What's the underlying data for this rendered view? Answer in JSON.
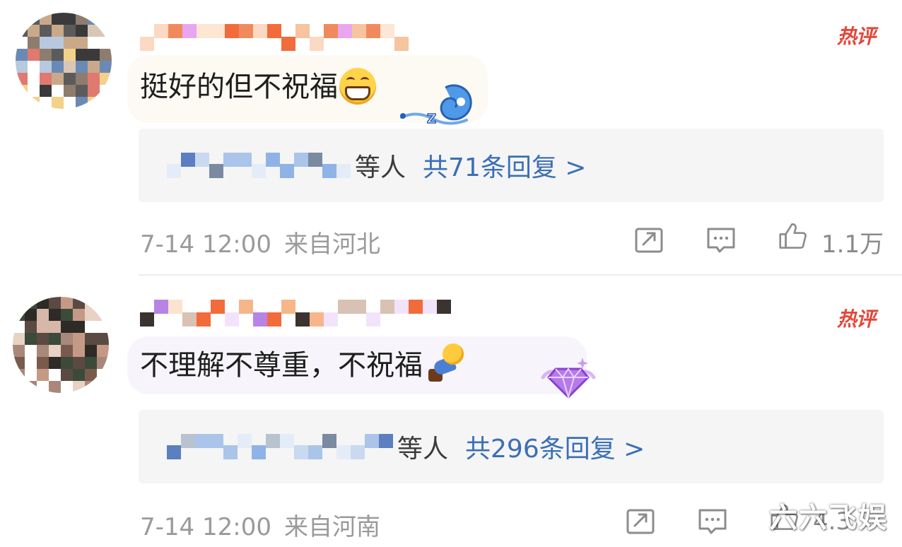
{
  "comments": [
    {
      "hot_label": "热评",
      "text": "挺好的但不祝福",
      "emoji": "grinning-face-emoji",
      "sticker": "wave-badge-sticker",
      "reply_suffix": "等人",
      "reply_count": "共71条回复 >",
      "time": "7-14 12:00",
      "location": "来自河北",
      "like_count": "1.1万"
    },
    {
      "hot_label": "热评",
      "text": "不理解不尊重，不祝福",
      "emoji": "kneeling-person-emoji",
      "sticker": "purple-gem-badge-sticker",
      "reply_suffix": "等人",
      "reply_count": "共296条回复 >",
      "time": "7-14 12:00",
      "location": "来自河南",
      "like_count": "4.3"
    }
  ],
  "icons": {
    "share": "share-icon",
    "comment": "comment-icon",
    "like": "thumbs-up-icon"
  },
  "colors": {
    "hot": "#e3473a",
    "link": "#3b6fb6",
    "meta": "#9a9a9a",
    "reply_bg": "#f5f5f5"
  },
  "watermark": "六六飞娱"
}
